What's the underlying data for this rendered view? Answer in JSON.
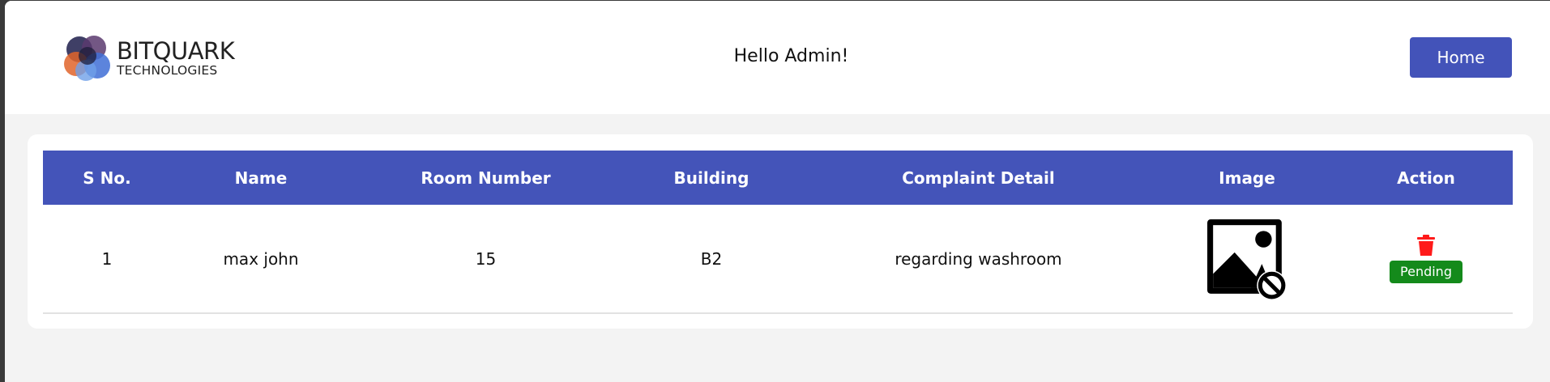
{
  "header": {
    "logo": {
      "line1": "BITQUARK",
      "line2": "TECHNOLOGIES"
    },
    "greeting": "Hello Admin!",
    "home_label": "Home"
  },
  "table": {
    "columns": [
      "S No.",
      "Name",
      "Room Number",
      "Building",
      "Complaint Detail",
      "Image",
      "Action"
    ],
    "rows": [
      {
        "sno": "1",
        "name": "max john",
        "room": "15",
        "building": "B2",
        "detail": "regarding washroom",
        "image_icon": "broken-image-icon",
        "action_icon": "trash-icon",
        "status": "Pending"
      }
    ]
  },
  "colors": {
    "primary": "#4454b9",
    "status_pending": "#148a1b",
    "delete": "#ff1a1a"
  }
}
